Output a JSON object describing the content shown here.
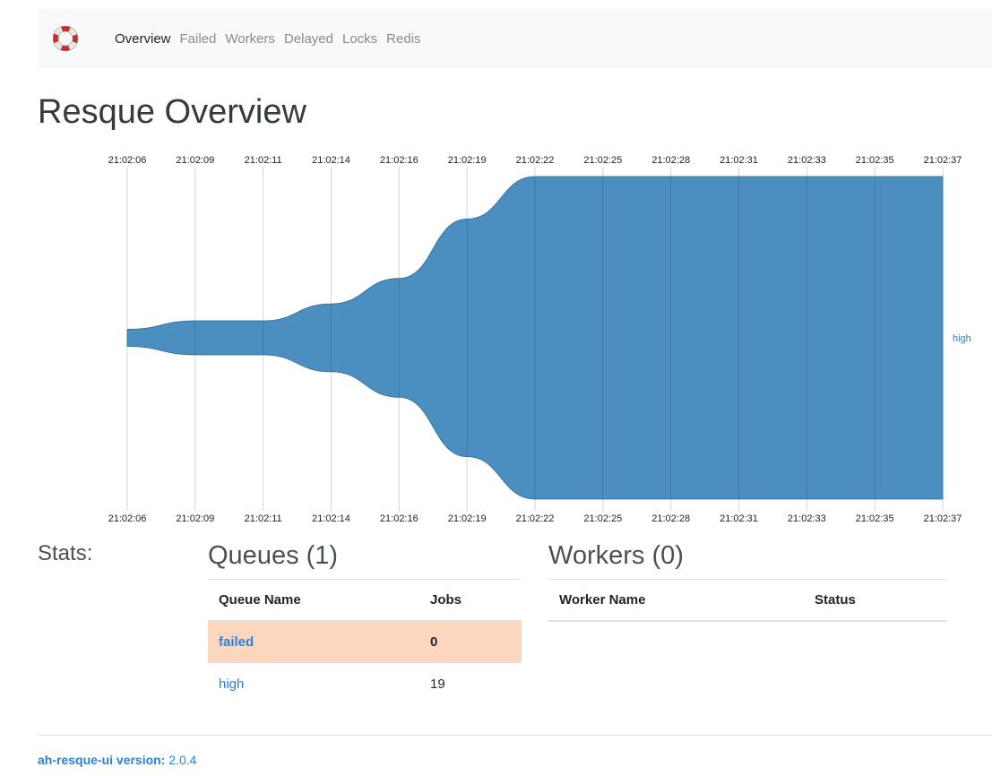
{
  "nav": {
    "logo": "lifebuoy-icon",
    "items": [
      {
        "label": "Overview",
        "active": true
      },
      {
        "label": "Failed"
      },
      {
        "label": "Workers"
      },
      {
        "label": "Delayed"
      },
      {
        "label": "Locks"
      },
      {
        "label": "Redis"
      }
    ]
  },
  "page": {
    "title": "Resque Overview"
  },
  "chart_data": {
    "type": "area",
    "style": "streamgraph",
    "x": [
      "21:02:06",
      "21:02:09",
      "21:02:11",
      "21:02:14",
      "21:02:16",
      "21:02:19",
      "21:02:22",
      "21:02:25",
      "21:02:28",
      "21:02:31",
      "21:02:33",
      "21:02:35",
      "21:02:37"
    ],
    "series": [
      {
        "name": "high",
        "values": [
          1,
          2,
          2,
          4,
          7,
          14,
          19,
          19,
          19,
          19,
          19,
          19,
          19
        ],
        "color": "#4b8fc1"
      }
    ],
    "grid": true,
    "tick_labels": "top and bottom"
  },
  "stats": {
    "label": "Stats:"
  },
  "queues": {
    "title": "Queues (1)",
    "headers": {
      "name": "Queue Name",
      "jobs": "Jobs"
    },
    "rows": [
      {
        "name": "failed",
        "jobs": "0",
        "highlight": true
      },
      {
        "name": "high",
        "jobs": "19"
      }
    ]
  },
  "workers": {
    "title": "Workers (0)",
    "headers": {
      "name": "Worker Name",
      "status": "Status"
    }
  },
  "footer": {
    "version_label": "ah-resque-ui version:",
    "version": "2.0.4"
  }
}
